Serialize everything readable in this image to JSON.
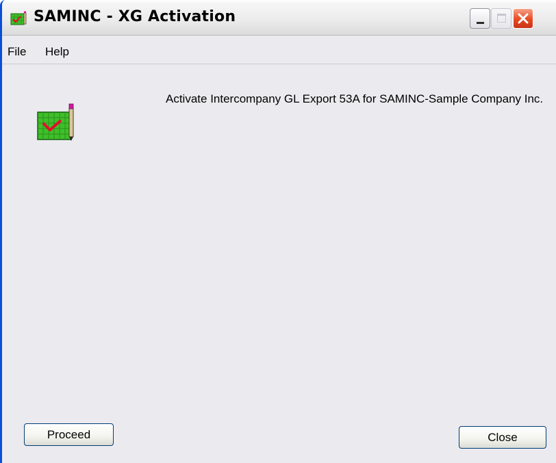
{
  "window": {
    "title": "SAMINC - XG Activation",
    "app_icon": "activation-checklist-icon"
  },
  "titlebar_buttons": {
    "minimize": "minimize-icon",
    "maximize": "maximize-icon",
    "close": "close-icon"
  },
  "menu": {
    "items": [
      {
        "label": "File"
      },
      {
        "label": "Help"
      }
    ]
  },
  "content": {
    "icon": "activation-checklist-icon",
    "message": "Activate Intercompany GL Export 53A for SAMINC-Sample Company Inc."
  },
  "buttons": {
    "proceed": "Proceed",
    "close": "Close"
  },
  "colors": {
    "window_frame": "#0a4fd6",
    "close_button": "#e64a21",
    "icon_green": "#3fbf2a",
    "check_red": "#e0102a"
  }
}
